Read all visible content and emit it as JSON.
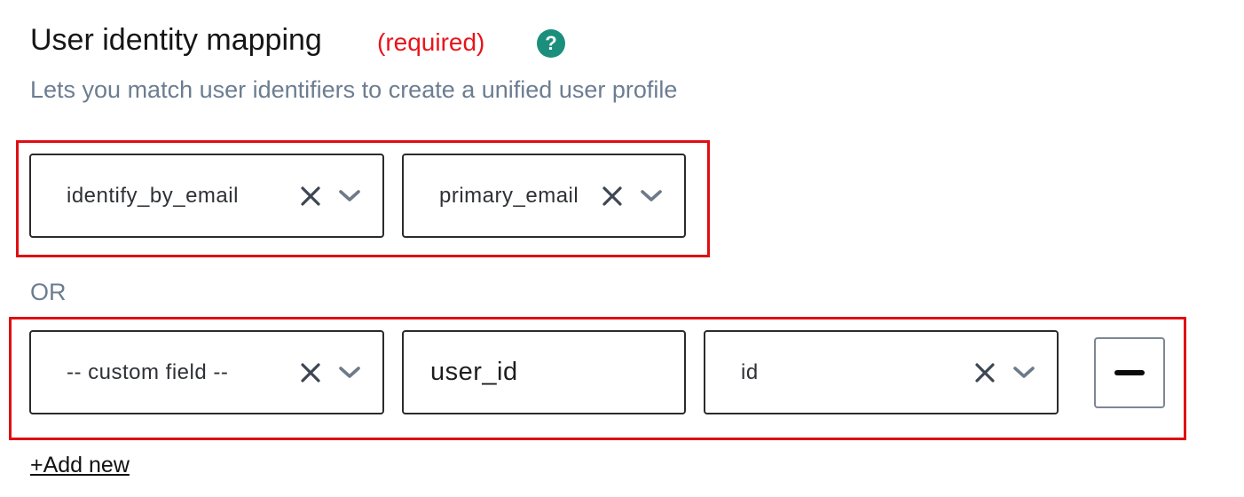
{
  "header": {
    "title": "User identity mapping",
    "required_label": "(required)",
    "help_glyph": "?",
    "subtitle": "Lets you match user identifiers to create a unified user profile"
  },
  "mapping_rows": [
    {
      "fields": [
        {
          "type": "select",
          "value": "identify_by_email"
        },
        {
          "type": "select",
          "value": "primary_email"
        }
      ]
    },
    {
      "fields": [
        {
          "type": "select",
          "value": "-- custom field --"
        },
        {
          "type": "text",
          "value": "user_id"
        },
        {
          "type": "select",
          "value": "id"
        }
      ]
    }
  ],
  "separator_label": "OR",
  "add_new_label": "+Add new",
  "colors": {
    "required": "#e8141b",
    "help_badge": "#1b8f7c",
    "highlight_border": "#e00e12",
    "muted_text": "#6c7d91"
  },
  "icons": {
    "clear": "close-icon",
    "dropdown": "chevron-down-icon",
    "help": "question-mark-icon",
    "remove": "minus-icon"
  }
}
